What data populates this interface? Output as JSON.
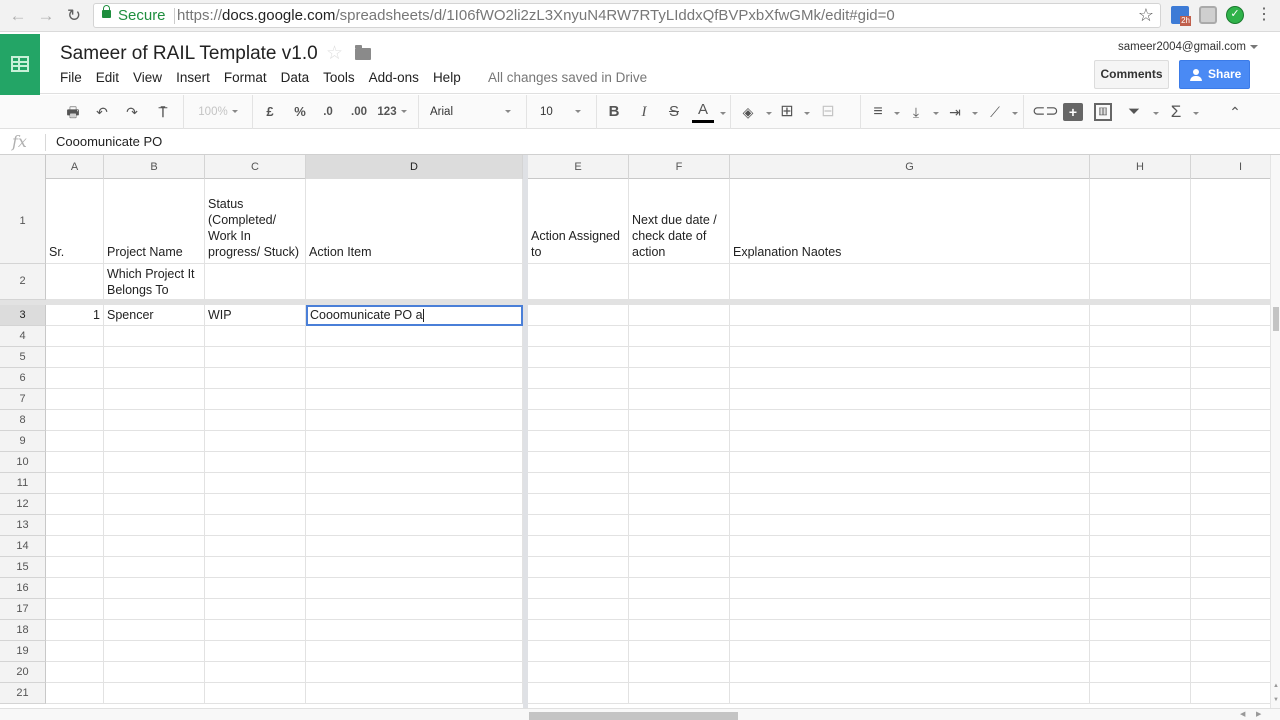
{
  "browser": {
    "secure_label": "Secure",
    "url_scheme": "https://",
    "url_host": "docs.google.com",
    "url_path": "/spreadsheets/d/1I06fWO2li2zL3XnyuN4RW7RTyLIddxQfBVPxbXfwGMk/edit#gid=0",
    "extension_badge": "2h"
  },
  "header": {
    "title": "Sameer of RAIL Template v1.0",
    "menus": [
      "File",
      "Edit",
      "View",
      "Insert",
      "Format",
      "Data",
      "Tools",
      "Add-ons",
      "Help"
    ],
    "save_status": "All changes saved in Drive",
    "account": "sameer2004@gmail.com",
    "comments_label": "Comments",
    "share_label": "Share"
  },
  "toolbar": {
    "zoom": "100%",
    "currency": "£",
    "percent": "%",
    "decimal_less": ".0",
    "decimal_more": ".00",
    "number_format": "123",
    "font": "Arial",
    "font_size": "10",
    "bold": "B",
    "italic": "I",
    "strike": "S",
    "text_color": "A",
    "sum": "Σ"
  },
  "formula_bar": {
    "fx": "fx",
    "value": "Cooomunicate PO"
  },
  "columns": [
    "A",
    "B",
    "C",
    "D",
    "E",
    "F",
    "G",
    "H",
    "I"
  ],
  "active_column": "D",
  "rows": {
    "r1": {
      "A": "Sr.",
      "B": "Project Name",
      "C": "Status (Completed/ Work In progress/ Stuck)",
      "D": "Action Item",
      "E": "Action Assigned to",
      "F": "Next due date / check date of action",
      "G": "Explanation Naotes"
    },
    "r2": {
      "B": "Which Project It Belongs To"
    },
    "r3": {
      "A": "1",
      "B": "Spencer",
      "C": "WIP"
    }
  },
  "row_numbers": [
    "1",
    "2",
    "3",
    "4",
    "5",
    "6",
    "7",
    "8",
    "9",
    "10",
    "11",
    "12",
    "13",
    "14",
    "15",
    "16",
    "17",
    "18",
    "19",
    "20",
    "21"
  ],
  "active_row": "3",
  "editor": {
    "cell": "D3",
    "value": "Cooomunicate PO a"
  }
}
